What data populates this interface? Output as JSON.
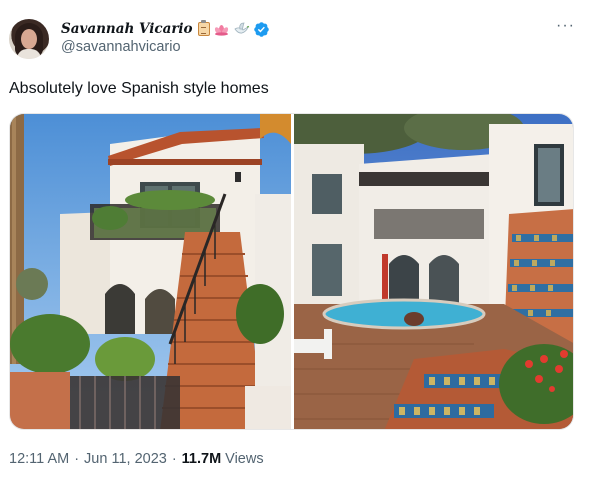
{
  "author": {
    "display_name": "Savannah Vicario",
    "handle": "@savannahvicario",
    "name_emojis": [
      "clipboard-emoji",
      "lotus-emoji",
      "dove-emoji"
    ],
    "verified": true
  },
  "more_label": "···",
  "tweet": {
    "text": "Absolutely love Spanish style homes"
  },
  "media": [
    {
      "kind": "photo",
      "subject": "white-stucco-house-with-tiled-staircase"
    },
    {
      "kind": "photo",
      "subject": "courtyard-pool-with-tiled-stairs"
    }
  ],
  "meta": {
    "time": "12:11 AM",
    "separator": "·",
    "date": "Jun 11, 2023",
    "views_count": "11.7M",
    "views_label": "Views"
  },
  "colors": {
    "text": "#0f1419",
    "secondary": "#536471",
    "verified": "#1d9bf0"
  }
}
